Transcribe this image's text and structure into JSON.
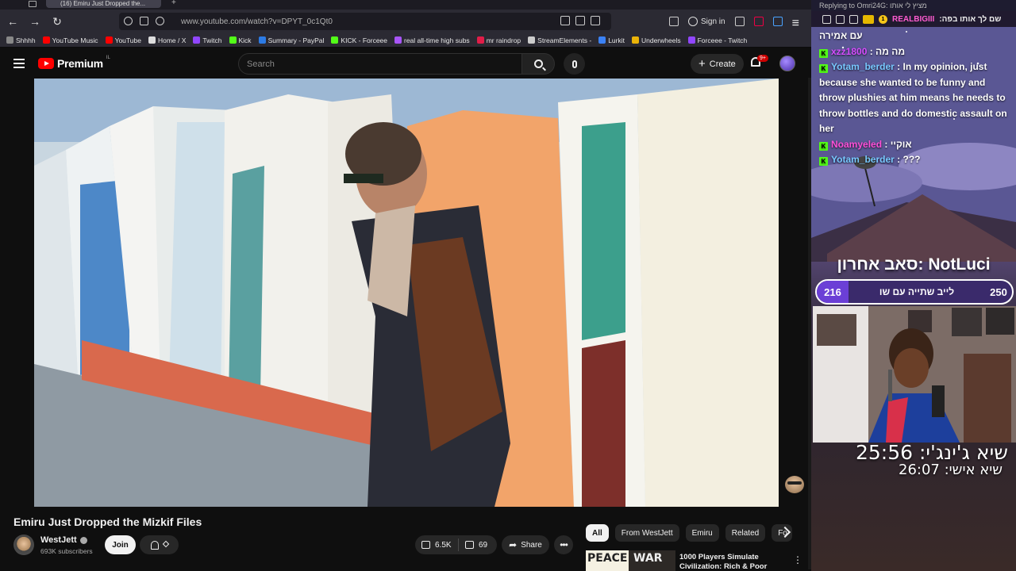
{
  "browser": {
    "tab_title": "(16) Emiru Just Dropped the...",
    "url": "www.youtube.com/watch?v=DPYT_0c1Qt0",
    "sign_in": "Sign in",
    "bookmarks": [
      {
        "label": "Shhhh",
        "color": "#888888"
      },
      {
        "label": "YouTube Music",
        "color": "#ff0000"
      },
      {
        "label": "YouTube",
        "color": "#ff0000"
      },
      {
        "label": "Home / X",
        "color": "#dddddd"
      },
      {
        "label": "Twitch",
        "color": "#9146ff"
      },
      {
        "label": "Kick",
        "color": "#53fc18"
      },
      {
        "label": "Summary - PayPal",
        "color": "#2c7be5"
      },
      {
        "label": "KICK - Forceee",
        "color": "#53fc18"
      },
      {
        "label": "real all-time high subs",
        "color": "#a855f7"
      },
      {
        "label": "mr raindrop",
        "color": "#e11d48"
      },
      {
        "label": "StreamElements -",
        "color": "#cccccc"
      },
      {
        "label": "Lurkit",
        "color": "#3b82f6"
      },
      {
        "label": "Underwheels",
        "color": "#eab308"
      },
      {
        "label": "Forceee - Twitch",
        "color": "#9146ff"
      }
    ]
  },
  "youtube": {
    "logo_text": "Premium",
    "logo_region": "IL",
    "search_placeholder": "Search",
    "create_label": "Create",
    "notif_count": "9+",
    "video_title": "Emiru Just Dropped the Mizkif Files",
    "channel_name": "WestJett",
    "subscribers": "693K subscribers",
    "join_label": "Join",
    "likes": "6.5K",
    "dislikes": "69",
    "share_label": "Share",
    "chips": [
      "All",
      "From WestJett",
      "Emiru",
      "Related",
      "Fo"
    ],
    "recommended": {
      "thumb_left": "PEACE",
      "thumb_right": "WAR",
      "title": "1000 Players Simulate Civilization: Rich & Poor"
    }
  },
  "overlay": {
    "reply_text": "Replying to Omri24G: מציץ לי אותו",
    "top_user": "REALBIGIII",
    "top_badge_num": "1",
    "top_text": "שם לך אותו בפה:",
    "chat": [
      {
        "user": "",
        "text": "עם אמירה",
        "platform": ""
      },
      {
        "user": "xzz1800",
        "text": "מה מה",
        "platform": "K"
      },
      {
        "user": "Yotam_berder",
        "text": "In my opinion, just because she wanted to be funny and throw plushies at him means he needs to throw bottles and do domestic assault on her",
        "platform": "K"
      },
      {
        "user": "Noamyeled",
        "text": "אוקיי",
        "platform": "K"
      },
      {
        "user": "Yotam_berder",
        "text": "???",
        "platform": "K"
      }
    ],
    "sub_title": "סאב אחרון: NotLuci",
    "poll_left": "216",
    "poll_text": "לייב שתייה עם שו",
    "poll_right": "250",
    "timer1": "שיא ג'ינג'י: 25:56",
    "timer2": "שיא אישי: 26:07"
  }
}
